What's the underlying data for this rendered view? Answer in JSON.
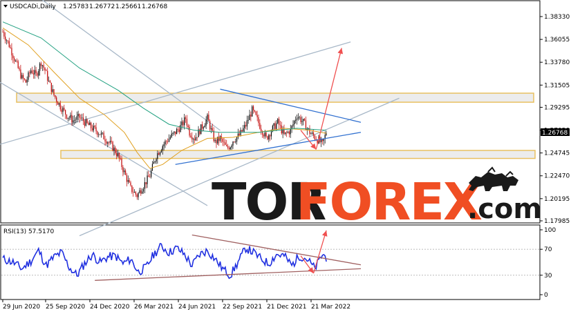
{
  "header": {
    "symbol": "USDCADi,Daily",
    "open": "1.25783",
    "high": "1.26772",
    "low": "1.25661",
    "close": "1.26768"
  },
  "price_label": "1.26768",
  "rsi_header": "RSI(13) 57.5170",
  "watermark": {
    "part1": "TOR",
    "part2": "FOREX",
    "part3": ".com"
  },
  "colors": {
    "candle_up": "#000000",
    "candle_down": "#c00000",
    "ma_fast": "#e0a020",
    "ma_slow": "#20a080",
    "zone": "#e8c060",
    "channel": "#a8b8c8",
    "triangle": "#3070d0",
    "arrow": "#f05050",
    "rsi_line": "#1f2fe0",
    "rsi_trend": "#a06060",
    "brand_orange": "#f04e23"
  },
  "chart_data": [
    {
      "type": "candlestick",
      "title": "USDCADi,Daily",
      "x_dates": [
        "29 Jun 2020",
        "25 Sep 2020",
        "24 Dec 2020",
        "26 Mar 2021",
        "24 Jun 2021",
        "22 Sep 2021",
        "21 Dec 2021",
        "21 Mar 2022"
      ],
      "y_ticks": [
        "1.38330",
        "1.36055",
        "1.33780",
        "1.31505",
        "1.29295",
        "1.27020",
        "1.24745",
        "1.22470",
        "1.20195",
        "1.17985"
      ],
      "ylim": [
        1.17985,
        1.3833
      ],
      "last_price": 1.26768,
      "close_path": [
        [
          0,
          1.368
        ],
        [
          5,
          1.355
        ],
        [
          10,
          1.338
        ],
        [
          15,
          1.322
        ],
        [
          18,
          1.318
        ],
        [
          22,
          1.33
        ],
        [
          26,
          1.325
        ],
        [
          30,
          1.338
        ],
        [
          33,
          1.33
        ],
        [
          36,
          1.318
        ],
        [
          40,
          1.305
        ],
        [
          45,
          1.294
        ],
        [
          50,
          1.285
        ],
        [
          55,
          1.28
        ],
        [
          60,
          1.283
        ],
        [
          65,
          1.277
        ],
        [
          70,
          1.272
        ],
        [
          75,
          1.268
        ],
        [
          80,
          1.262
        ],
        [
          85,
          1.255
        ],
        [
          90,
          1.245
        ],
        [
          95,
          1.228
        ],
        [
          100,
          1.212
        ],
        [
          105,
          1.205
        ],
        [
          110,
          1.215
        ],
        [
          115,
          1.225
        ],
        [
          120,
          1.245
        ],
        [
          125,
          1.255
        ],
        [
          130,
          1.262
        ],
        [
          135,
          1.268
        ],
        [
          140,
          1.275
        ],
        [
          143,
          1.282
        ],
        [
          146,
          1.268
        ],
        [
          150,
          1.262
        ],
        [
          155,
          1.272
        ],
        [
          160,
          1.282
        ],
        [
          163,
          1.27
        ],
        [
          166,
          1.258
        ],
        [
          170,
          1.262
        ],
        [
          175,
          1.252
        ],
        [
          178,
          1.255
        ],
        [
          180,
          1.26
        ],
        [
          185,
          1.265
        ],
        [
          190,
          1.275
        ],
        [
          195,
          1.29
        ],
        [
          198,
          1.283
        ],
        [
          202,
          1.272
        ],
        [
          206,
          1.262
        ],
        [
          210,
          1.27
        ],
        [
          215,
          1.278
        ],
        [
          220,
          1.265
        ],
        [
          225,
          1.27
        ],
        [
          230,
          1.285
        ],
        [
          235,
          1.278
        ],
        [
          240,
          1.268
        ],
        [
          245,
          1.262
        ],
        [
          250,
          1.256
        ],
        [
          253,
          1.268
        ]
      ],
      "support_zone": [
        1.242,
        1.25
      ],
      "resistance_zone": [
        1.298,
        1.307
      ],
      "ma_fast": [
        [
          0,
          1.372
        ],
        [
          20,
          1.355
        ],
        [
          40,
          1.328
        ],
        [
          60,
          1.302
        ],
        [
          80,
          1.285
        ],
        [
          95,
          1.268
        ],
        [
          105,
          1.248
        ],
        [
          115,
          1.232
        ],
        [
          125,
          1.236
        ],
        [
          140,
          1.25
        ],
        [
          160,
          1.262
        ],
        [
          180,
          1.263
        ],
        [
          200,
          1.268
        ],
        [
          220,
          1.272
        ],
        [
          240,
          1.27
        ],
        [
          253,
          1.267
        ]
      ],
      "ma_slow": [
        [
          0,
          1.378
        ],
        [
          30,
          1.362
        ],
        [
          60,
          1.332
        ],
        [
          90,
          1.31
        ],
        [
          110,
          1.292
        ],
        [
          130,
          1.276
        ],
        [
          150,
          1.27
        ],
        [
          170,
          1.268
        ],
        [
          200,
          1.268
        ],
        [
          230,
          1.272
        ],
        [
          253,
          1.27
        ]
      ],
      "channel_lines": [
        [
          [
            -5,
            1.32
          ],
          [
            160,
            1.195
          ]
        ],
        [
          [
            20,
            1.41
          ],
          [
            170,
            1.27
          ]
        ],
        [
          [
            -5,
            1.255
          ],
          [
            272,
            1.358
          ]
        ],
        [
          [
            60,
            1.165
          ],
          [
            310,
            1.302
          ]
        ]
      ],
      "triangle_lines": [
        [
          [
            170,
            1.311
          ],
          [
            280,
            1.278
          ]
        ],
        [
          [
            135,
            1.236
          ],
          [
            280,
            1.268
          ]
        ]
      ],
      "arrows": [
        [
          [
            233,
            1.27
          ],
          [
            245,
            1.251
          ]
        ],
        [
          [
            245,
            1.251
          ],
          [
            265,
            1.352
          ]
        ]
      ]
    },
    {
      "type": "line",
      "title": "RSI(13) 57.5170",
      "y_ticks": [
        "100",
        "70",
        "30",
        "0"
      ],
      "levels": [
        70,
        30
      ],
      "ylim": [
        0,
        100
      ],
      "last_value": 57.517,
      "rsi_path": [
        [
          0,
          55
        ],
        [
          8,
          50
        ],
        [
          15,
          40
        ],
        [
          22,
          52
        ],
        [
          28,
          68
        ],
        [
          34,
          45
        ],
        [
          40,
          58
        ],
        [
          46,
          65
        ],
        [
          52,
          42
        ],
        [
          58,
          30
        ],
        [
          64,
          48
        ],
        [
          70,
          62
        ],
        [
          76,
          50
        ],
        [
          82,
          58
        ],
        [
          88,
          60
        ],
        [
          94,
          48
        ],
        [
          100,
          55
        ],
        [
          106,
          35
        ],
        [
          112,
          42
        ],
        [
          118,
          62
        ],
        [
          124,
          75
        ],
        [
          130,
          65
        ],
        [
          136,
          72
        ],
        [
          142,
          62
        ],
        [
          148,
          45
        ],
        [
          154,
          62
        ],
        [
          160,
          68
        ],
        [
          166,
          55
        ],
        [
          172,
          40
        ],
        [
          178,
          30
        ],
        [
          184,
          50
        ],
        [
          190,
          72
        ],
        [
          196,
          65
        ],
        [
          202,
          55
        ],
        [
          208,
          48
        ],
        [
          214,
          62
        ],
        [
          220,
          60
        ],
        [
          226,
          45
        ],
        [
          232,
          60
        ],
        [
          238,
          55
        ],
        [
          244,
          40
        ],
        [
          250,
          62
        ],
        [
          253,
          57.5
        ]
      ],
      "trend_lines": [
        [
          [
            148,
            92
          ],
          [
            280,
            46
          ]
        ],
        [
          [
            72,
            22
          ],
          [
            280,
            40
          ]
        ]
      ],
      "arrows": [
        [
          [
            233,
            60
          ],
          [
            243,
            33
          ]
        ],
        [
          [
            243,
            33
          ],
          [
            253,
            99
          ]
        ]
      ]
    }
  ]
}
